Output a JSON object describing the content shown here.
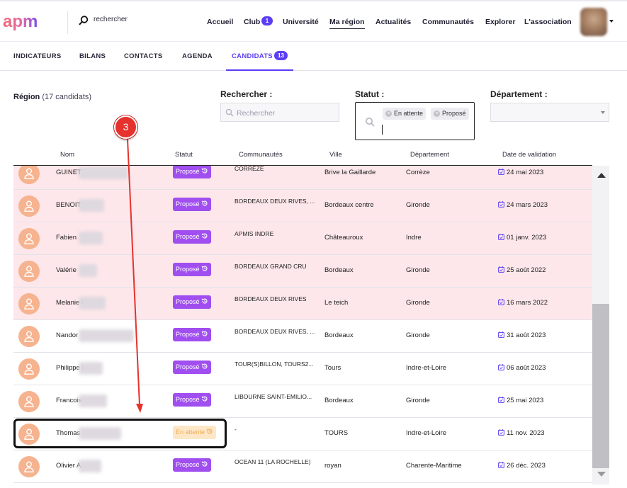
{
  "header": {
    "logo_text": "apm",
    "search_text": "rechercher",
    "nav": [
      {
        "label": "Accueil"
      },
      {
        "label": "Club",
        "badge": "1"
      },
      {
        "label": "Université"
      },
      {
        "label": "Ma région",
        "active": true
      },
      {
        "label": "Actualités"
      },
      {
        "label": "Communautés"
      },
      {
        "label": "Explorer"
      },
      {
        "label": "L'association"
      }
    ]
  },
  "tabs": [
    {
      "label": "INDICATEURS"
    },
    {
      "label": "BILANS"
    },
    {
      "label": "CONTACTS"
    },
    {
      "label": "AGENDA"
    },
    {
      "label": "CANDIDATS",
      "badge": "13",
      "active": true
    }
  ],
  "filters": {
    "region_title": "Région",
    "region_count": "(17 candidats)",
    "search_label": "Rechercher :",
    "search_placeholder": "Rechercher",
    "statut_label": "Statut :",
    "statut_chips": [
      "En attente",
      "Proposé"
    ],
    "departement_label": "Département :"
  },
  "table": {
    "columns": [
      "Nom",
      "Statut",
      "Communautés",
      "Ville",
      "Département",
      "Date de validation"
    ],
    "rows": [
      {
        "name": "GUINET",
        "status": "Proposé",
        "community": "CORRÈZE",
        "city": "Brive la Gaillarde",
        "dept": "Corrèze",
        "date": "24 mai 2023",
        "highlighted": true
      },
      {
        "name": "BENOIT",
        "status": "Proposé",
        "community": "BORDEAUX DEUX RIVES, ...",
        "city": "Bordeaux centre",
        "dept": "Gironde",
        "date": "24 mars 2023",
        "highlighted": true
      },
      {
        "name": "Fabien",
        "status": "Proposé",
        "community": "APMIS INDRE",
        "city": "Châteauroux",
        "dept": "Indre",
        "date": "01 janv. 2023",
        "highlighted": true
      },
      {
        "name": "Valérie",
        "status": "Proposé",
        "community": "BORDEAUX GRAND CRU",
        "city": "Bordeaux",
        "dept": "Gironde",
        "date": "25 août 2022",
        "highlighted": true
      },
      {
        "name": "Melanie I",
        "status": "Proposé",
        "community": "BORDEAUX DEUX RIVES",
        "city": "Le teich",
        "dept": "Gironde",
        "date": "16 mars 2022",
        "highlighted": true
      },
      {
        "name": "Nandor",
        "status": "Proposé",
        "community": "BORDEAUX DEUX RIVES, ...",
        "city": "Bordeaux",
        "dept": "Gironde",
        "date": "31 août 2023",
        "highlighted": false
      },
      {
        "name": "Philippe I",
        "status": "Proposé",
        "community": "TOUR(S)BILLON, TOURS2...",
        "city": "Tours",
        "dept": "Indre-et-Loire",
        "date": "06 août 2023",
        "highlighted": false
      },
      {
        "name": "Francois",
        "status": "Proposé",
        "community": "LIBOURNE SAINT-EMILIO...",
        "city": "Bordeaux",
        "dept": "Gironde",
        "date": "25 mai 2023",
        "highlighted": false
      },
      {
        "name": "Thomas",
        "status": "En attente",
        "community": "-",
        "city": "TOURS",
        "dept": "Indre-et-Loire",
        "date": "11 nov. 2023",
        "highlighted": false
      },
      {
        "name": "Olivier A",
        "status": "Proposé",
        "community": "OCEAN 11 (LA ROCHELLE)",
        "city": "royan",
        "dept": "Charente-Maritime",
        "date": "26 déc. 2023",
        "highlighted": false
      }
    ]
  },
  "annotation": {
    "step_number": "3"
  },
  "colors": {
    "accent": "#5b3df5",
    "proposed": "#a04ef0",
    "waiting_bg": "#fde7c7",
    "row_pink": "#fde7ea",
    "avatar": "#f6b38f",
    "annotation_red": "#e5322d"
  }
}
